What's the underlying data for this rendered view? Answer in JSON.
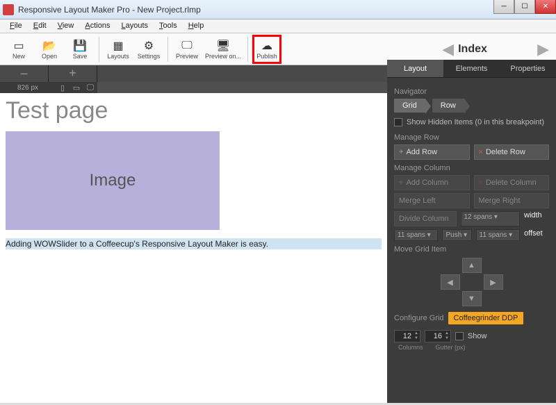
{
  "window": {
    "title": "Responsive Layout Maker Pro - New Project.rlmp"
  },
  "menu": [
    "File",
    "Edit",
    "View",
    "Actions",
    "Layouts",
    "Tools",
    "Help"
  ],
  "toolbar": {
    "new": "New",
    "open": "Open",
    "save": "Save",
    "layouts": "Layouts",
    "settings": "Settings",
    "preview": "Preview",
    "preview_on": "Preview on...",
    "publish": "Publish",
    "index": "Index"
  },
  "breakpoint": {
    "width_label": "826 px"
  },
  "canvas": {
    "title": "Test page",
    "image_label": "Image",
    "body": "Adding WOWSlider to a  Coffeecup's Responsive Layout Maker is easy."
  },
  "panel": {
    "tabs": [
      "Layout",
      "Elements",
      "Properties"
    ],
    "navigator": "Navigator",
    "crumbs": [
      "Grid",
      "Row"
    ],
    "show_hidden": "Show Hidden Items (0 in this breakpoint)",
    "manage_row": "Manage Row",
    "add_row": "Add Row",
    "delete_row": "Delete Row",
    "manage_col": "Manage Column",
    "add_col": "Add Column",
    "delete_col": "Delete Column",
    "merge_left": "Merge Left",
    "merge_right": "Merge Right",
    "divide_col": "Divide Column",
    "spans12": "12 spans",
    "width": "width",
    "spans11a": "11 spans",
    "push": "Push",
    "spans11b": "11 spans",
    "offset": "offset",
    "move_grid": "Move Grid Item",
    "configure_grid": "Configure Grid",
    "grid_name": "Coffeegrinder DDP",
    "columns_val": "12",
    "gutter_val": "16",
    "show": "Show",
    "columns_lbl": "Columns",
    "gutter_lbl": "Gutter (px)"
  }
}
